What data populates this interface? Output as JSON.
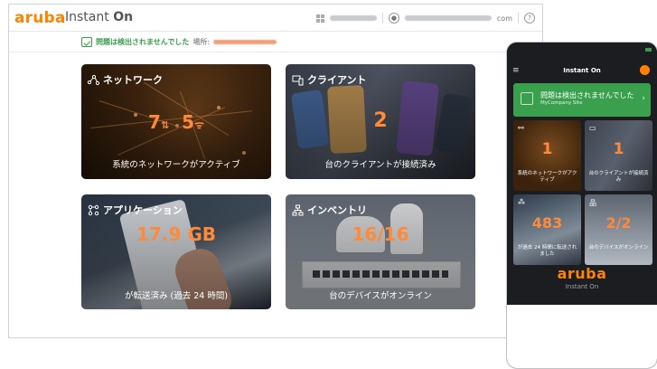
{
  "header": {
    "brand": "aruba",
    "product": "Instant",
    "product_on": "On",
    "domain_suffix": "com"
  },
  "status": {
    "message": "問題は検出されませんでした",
    "site_label": "場所:"
  },
  "tiles": {
    "network": {
      "title": "ネットワーク",
      "value_a": "7",
      "value_b": "5",
      "caption": "系統のネットワークがアクティブ"
    },
    "clients": {
      "title": "クライアント",
      "value": "2",
      "caption": "台のクライアントが接続済み"
    },
    "applications": {
      "title": "アプリケーション",
      "value": "17.9 GB",
      "caption": "が転送済み (過去 24 時間)"
    },
    "inventory": {
      "title": "インベントリ",
      "value": "16/16",
      "caption": "台のデバイスがオンライン"
    }
  },
  "phone": {
    "title": "Instant On",
    "status_message": "問題は検出されませんでした",
    "status_site": "MyCompany Site",
    "network_value": "1",
    "network_caption": "系統のネットワークがアクティブ",
    "clients_value": "1",
    "clients_caption": "台のクライアントが接続済み",
    "apps_value": "483",
    "apps_caption": "が過去 24 時間に転送されました",
    "inventory_value": "2/2",
    "inventory_caption": "台のデバイスがオンライン",
    "logo": "aruba",
    "logo_sub": "Instant On"
  },
  "colors": {
    "brand_orange": "#ff8300",
    "ok_green": "#3a9c4a"
  },
  "icons": {
    "network": "network-nodes-icon",
    "clients": "devices-icon",
    "applications": "apps-icon",
    "inventory": "inventory-tree-icon"
  }
}
